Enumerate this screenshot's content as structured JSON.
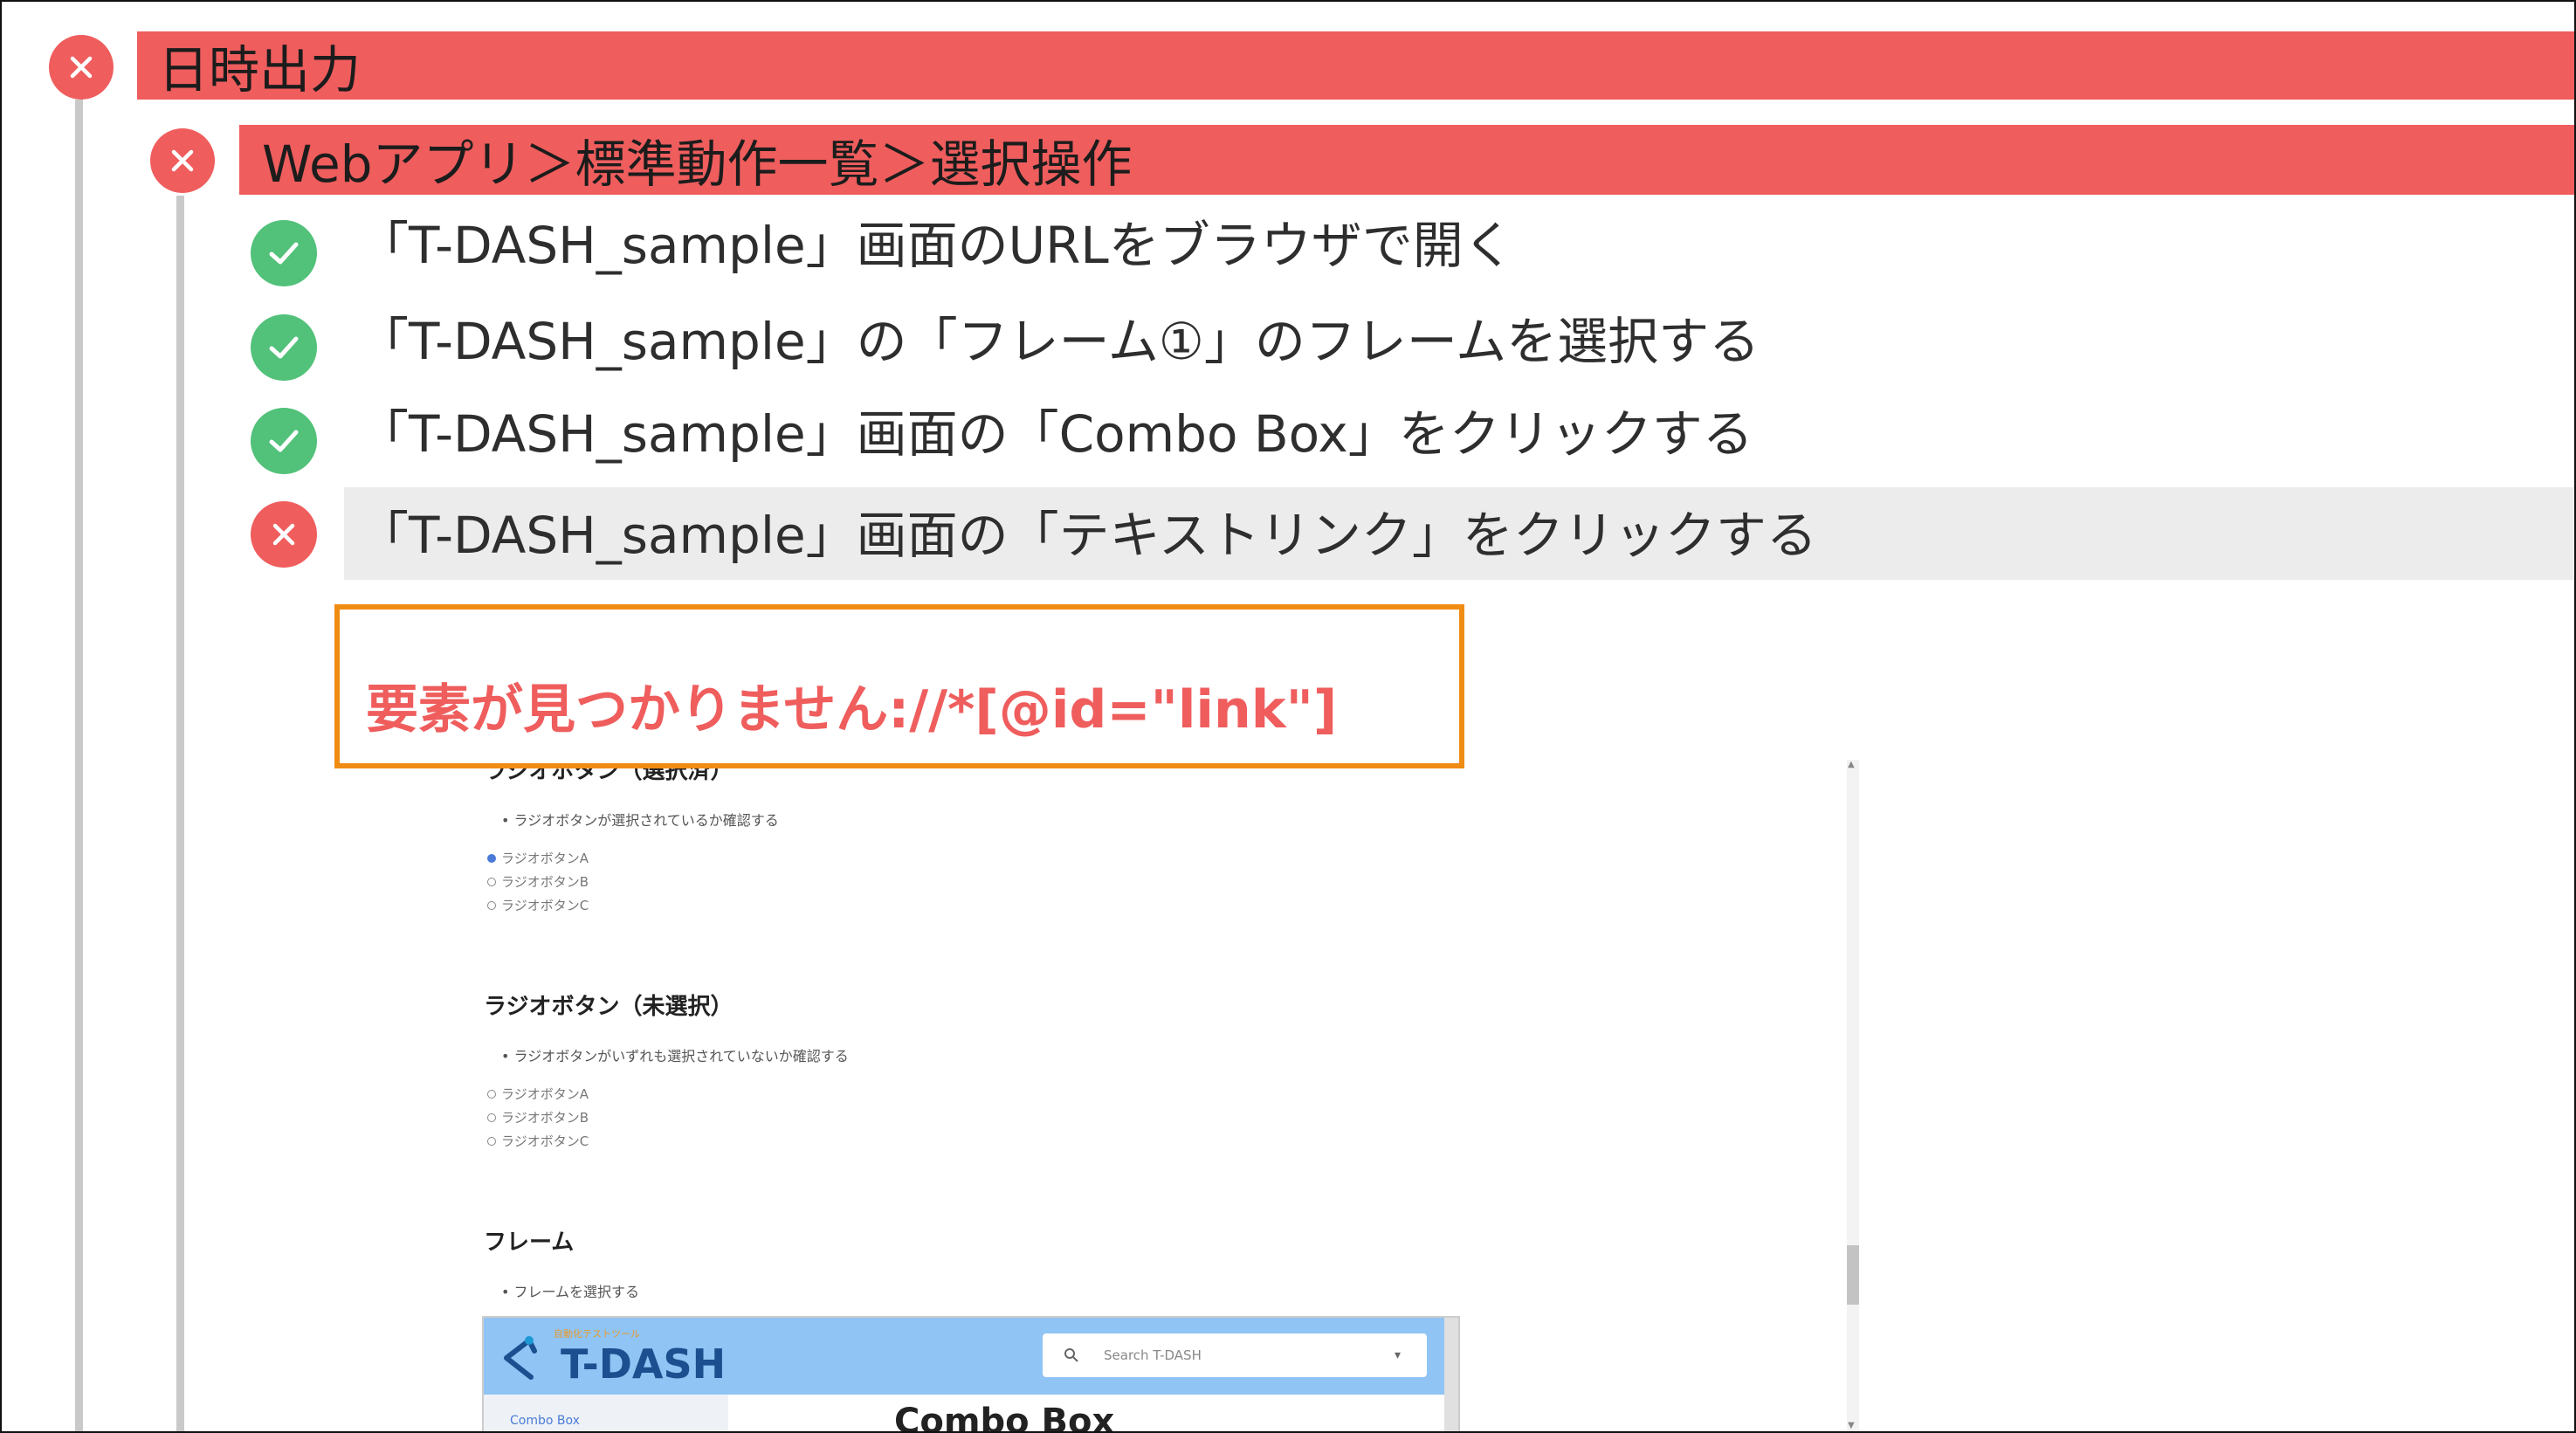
{
  "tree": {
    "level1": {
      "status": "fail",
      "title": "日時出力"
    },
    "level2": {
      "status": "fail",
      "title": "Webアプリ＞標準動作一覧＞選択操作"
    },
    "steps": [
      {
        "status": "pass",
        "label": "「T-DASH_sample」画面のURLをブラウザで開く"
      },
      {
        "status": "pass",
        "label": "「T-DASH_sample」の「フレーム①」のフレームを選択する"
      },
      {
        "status": "pass",
        "label": "「T-DASH_sample」画面の「Combo Box」をクリックする"
      },
      {
        "status": "fail",
        "label": "「T-DASH_sample」画面の「テキストリンク」をクリックする"
      }
    ]
  },
  "error": {
    "message": "要素が見つかりません://*[@id=\"link\"]"
  },
  "screenshot": {
    "section1": {
      "heading": "ラジオボタン（選択済）",
      "bullet": "ラジオボタンが選択されているか確認する",
      "options": [
        "ラジオボタンA",
        "ラジオボタンB",
        "ラジオボタンC"
      ]
    },
    "section2": {
      "heading": "ラジオボタン（未選択）",
      "bullet": "ラジオボタンがいずれも選択されていないか確認する",
      "options": [
        "ラジオボタンA",
        "ラジオボタンB",
        "ラジオボタンC"
      ]
    },
    "section3": {
      "heading": "フレーム",
      "bullet": "フレームを選択する"
    },
    "inner_app": {
      "logo_tagline": "自動化テストツール",
      "logo": "T-DASH",
      "search_placeholder": "Search T-DASH",
      "sidebar_item": "Combo Box",
      "page_title": "Combo Box"
    }
  },
  "colors": {
    "fail": "#ef5d5d",
    "pass": "#52c17a",
    "error_border": "#f08c14",
    "highlight": "#ececec"
  },
  "icons": {
    "fail": "close-icon",
    "pass": "check-icon"
  }
}
